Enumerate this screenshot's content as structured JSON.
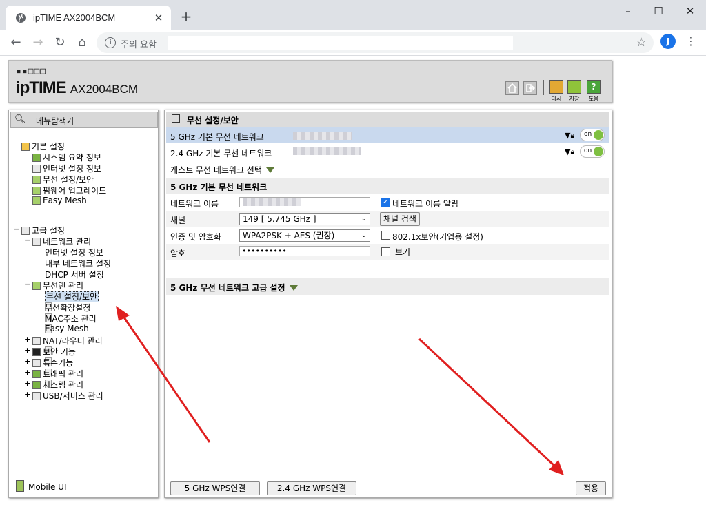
{
  "browser": {
    "tab_title": "ipTIME AX2004BCM",
    "new_tab": "+",
    "address_security": "주의 요함",
    "profile_initial": "J"
  },
  "header": {
    "logo_dots": "▪▪□□□",
    "logo_text": "ipTIME",
    "model": "AX2004BCM",
    "buttons": [
      "다시",
      "저장",
      "도움"
    ]
  },
  "left": {
    "title": "메뉴탐색기",
    "basic_title": "기본 설정",
    "basic_items": [
      "시스템 요약 정보",
      "인터넷 설정 정보",
      "무선 설정/보안",
      "펌웨어 업그레이드",
      "Easy Mesh"
    ],
    "adv_title": "고급 설정",
    "net_title": "네트워크 관리",
    "net_items": [
      "인터넷 설정 정보",
      "내부 네트워크 설정",
      "DHCP 서버 설정"
    ],
    "wlan_title": "무선랜 관리",
    "wlan_items": [
      "무선 설정/보안",
      "무선확장설정",
      "MAC주소 관리",
      "Easy Mesh"
    ],
    "more": [
      "NAT/라우터 관리",
      "보안 기능",
      "특수기능",
      "트래픽 관리",
      "시스템 관리",
      "USB/서비스 관리"
    ],
    "mobile": "Mobile UI"
  },
  "main": {
    "title": "무선 설정/보안",
    "net5": "5 GHz 기본 무선 네트워크",
    "net24": "2.4 GHz 기본 무선 네트워크",
    "toggle_label": "on",
    "guest": "게스트 무선 네트워크 선택",
    "section": "5 GHz 기본 무선 네트워크",
    "fields": {
      "name_label": "네트워크 이름",
      "name_notice": "네트워크 이름 알림",
      "channel_label": "채널",
      "channel_value": "149 [ 5.745 GHz ]",
      "channel_search": "채널 검색",
      "auth_label": "인증 및 암호화",
      "auth_value": "WPA2PSK + AES (권장)",
      "auth_8021x": "802.1x보안(기업용 설정)",
      "pw_label": "암호",
      "pw_value": "••••••••••",
      "show": "보기"
    },
    "adv_section": "5 GHz 무선 네트워크 고급 설정",
    "wps5": "5 GHz WPS연결",
    "wps24": "2.4 GHz WPS연결",
    "apply": "적용"
  }
}
